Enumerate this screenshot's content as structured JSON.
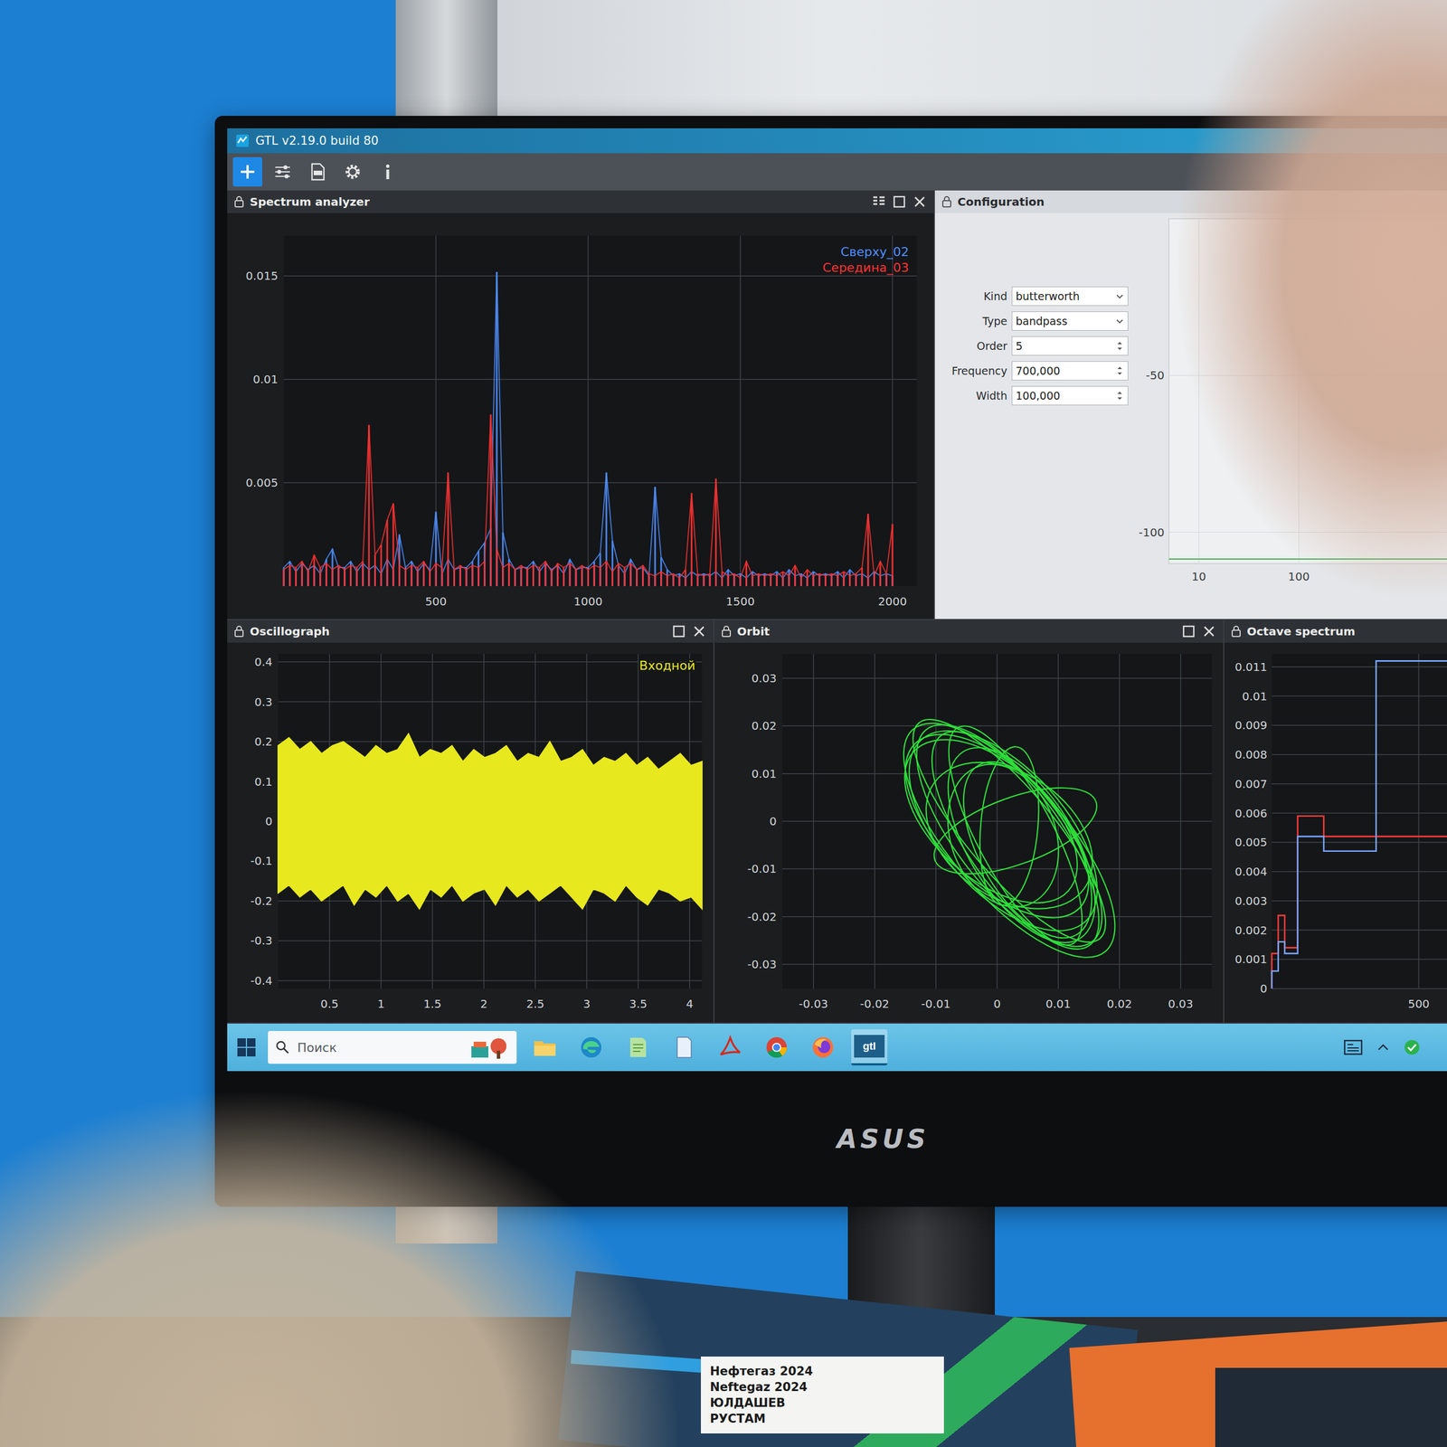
{
  "window": {
    "title": "GTL v2.19.0 build 80"
  },
  "toolbar": {
    "buttons": [
      {
        "kind": "add",
        "selected": true
      },
      {
        "kind": "connect",
        "selected": false
      },
      {
        "kind": "report",
        "selected": false
      },
      {
        "kind": "settings",
        "selected": false
      },
      {
        "kind": "info",
        "selected": false
      }
    ]
  },
  "spectrum": {
    "title": "Spectrum analyzer",
    "y_ticks": [
      "0.015",
      "0.01",
      "0.005"
    ],
    "x_ticks": [
      "500",
      "1000",
      "1500",
      "2000"
    ],
    "series": [
      {
        "name": "Сверху_02",
        "color": "#4f8fff",
        "values": [
          0.0009,
          0.0012,
          0.0007,
          0.0011,
          0.0008,
          0.001,
          0.0006,
          0.0013,
          0.0018,
          0.0009,
          0.0009,
          0.0012,
          0.0007,
          0.0011,
          0.0008,
          0.001,
          0.0006,
          0.0013,
          0.0008,
          0.0025,
          0.0009,
          0.0012,
          0.0007,
          0.0011,
          0.0008,
          0.0036,
          0.0006,
          0.0013,
          0.0008,
          0.0009,
          0.0009,
          0.0012,
          0.0017,
          0.0021,
          0.0028,
          0.0152,
          0.0026,
          0.0013,
          0.0008,
          0.0009,
          0.0009,
          0.0012,
          0.0007,
          0.0011,
          0.0008,
          0.001,
          0.0006,
          0.0013,
          0.0008,
          0.0009,
          0.0009,
          0.0012,
          0.0016,
          0.0055,
          0.0022,
          0.001,
          0.0006,
          0.0013,
          0.0008,
          0.0009,
          0.0005,
          0.0048,
          0.0014,
          0.0008,
          0.0005,
          0.0006,
          0.0004,
          0.0007,
          0.0005,
          0.0006,
          0.0005,
          0.0007,
          0.0004,
          0.0008,
          0.0005,
          0.0006,
          0.0004,
          0.0007,
          0.0005,
          0.0006,
          0.0005,
          0.0007,
          0.0004,
          0.0008,
          0.0005,
          0.0006,
          0.0004,
          0.0007,
          0.0005,
          0.0006,
          0.0005,
          0.0007,
          0.0004,
          0.0008,
          0.0005,
          0.0006,
          0.0004,
          0.0007,
          0.0005,
          0.0006,
          0.0005
        ]
      },
      {
        "name": "Середина_03",
        "color": "#ff3232",
        "values": [
          0.0008,
          0.001,
          0.0009,
          0.0012,
          0.0007,
          0.0015,
          0.0009,
          0.0011,
          0.0008,
          0.001,
          0.0008,
          0.001,
          0.0009,
          0.0012,
          0.0078,
          0.0015,
          0.002,
          0.0032,
          0.004,
          0.001,
          0.0008,
          0.001,
          0.0009,
          0.0012,
          0.0007,
          0.0011,
          0.0009,
          0.0055,
          0.0008,
          0.001,
          0.0008,
          0.001,
          0.0009,
          0.0012,
          0.0083,
          0.0018,
          0.0009,
          0.0011,
          0.0008,
          0.001,
          0.0008,
          0.001,
          0.0009,
          0.0012,
          0.0007,
          0.0011,
          0.0009,
          0.0011,
          0.0008,
          0.001,
          0.0008,
          0.001,
          0.0009,
          0.0012,
          0.0007,
          0.0011,
          0.0009,
          0.0011,
          0.0008,
          0.001,
          0.0006,
          0.0005,
          0.0007,
          0.0005,
          0.0006,
          0.0004,
          0.0008,
          0.0045,
          0.0006,
          0.0005,
          0.0006,
          0.0052,
          0.0007,
          0.0005,
          0.0006,
          0.0004,
          0.0012,
          0.0005,
          0.0006,
          0.0005,
          0.0006,
          0.0005,
          0.0007,
          0.0005,
          0.001,
          0.0004,
          0.0008,
          0.0005,
          0.0006,
          0.0005,
          0.0006,
          0.0005,
          0.0007,
          0.0005,
          0.0006,
          0.0009,
          0.0035,
          0.0005,
          0.0012,
          0.0006,
          0.003
        ]
      }
    ]
  },
  "configuration": {
    "title": "Configuration",
    "fields": [
      {
        "label": "Kind",
        "value": "butterworth",
        "kind": "select"
      },
      {
        "label": "Type",
        "value": "bandpass",
        "kind": "select"
      },
      {
        "label": "Order",
        "value": "5",
        "kind": "spin"
      },
      {
        "label": "Frequency",
        "value": "700,000",
        "kind": "spin"
      },
      {
        "label": "Width",
        "value": "100,000",
        "kind": "spin"
      }
    ],
    "chart": {
      "y_ticks": [
        "-50",
        "-100"
      ],
      "x_ticks": [
        "10",
        "100"
      ]
    }
  },
  "oscillograph": {
    "title": "Oscillograph",
    "y_ticks": [
      "0.4",
      "0.3",
      "0.2",
      "0.1",
      "0",
      "-0.1",
      "-0.2",
      "-0.3",
      "-0.4"
    ],
    "x_ticks": [
      "0.5",
      "1",
      "1.5",
      "2",
      "2.5",
      "3",
      "3.5",
      "4"
    ],
    "series": [
      {
        "name": "Входной",
        "color": "#e8e81e",
        "upper": [
          0.19,
          0.21,
          0.18,
          0.2,
          0.17,
          0.19,
          0.2,
          0.18,
          0.16,
          0.19,
          0.17,
          0.18,
          0.22,
          0.16,
          0.18,
          0.17,
          0.19,
          0.15,
          0.18,
          0.16,
          0.17,
          0.19,
          0.15,
          0.17,
          0.16,
          0.2,
          0.15,
          0.16,
          0.18,
          0.14,
          0.16,
          0.15,
          0.17,
          0.14,
          0.16,
          0.13,
          0.15,
          0.17,
          0.14,
          0.15
        ],
        "lower": [
          -0.18,
          -0.16,
          -0.19,
          -0.17,
          -0.2,
          -0.18,
          -0.16,
          -0.21,
          -0.17,
          -0.19,
          -0.16,
          -0.2,
          -0.18,
          -0.22,
          -0.17,
          -0.19,
          -0.16,
          -0.2,
          -0.18,
          -0.17,
          -0.21,
          -0.16,
          -0.19,
          -0.17,
          -0.2,
          -0.18,
          -0.16,
          -0.19,
          -0.22,
          -0.17,
          -0.18,
          -0.2,
          -0.16,
          -0.19,
          -0.21,
          -0.17,
          -0.18,
          -0.2,
          -0.19,
          -0.22
        ]
      }
    ]
  },
  "orbit": {
    "title": "Orbit",
    "y_ticks": [
      "0.03",
      "0.02",
      "0.01",
      "0",
      "-0.01",
      "-0.02",
      "-0.03"
    ],
    "x_ticks": [
      "-0.03",
      "-0.02",
      "-0.01",
      "0",
      "0.01",
      "0.02",
      "0.03"
    ],
    "color": "#2ee03a",
    "loops": [
      {
        "cx": 0.002,
        "cy": -0.003,
        "rx": 0.022,
        "ry": 0.011,
        "angle": 52
      },
      {
        "cx": 0.001,
        "cy": -0.002,
        "rx": 0.02,
        "ry": 0.013,
        "angle": 48
      },
      {
        "cx": 0.003,
        "cy": -0.004,
        "rx": 0.021,
        "ry": 0.01,
        "angle": 55
      },
      {
        "cx": 0.0,
        "cy": -0.001,
        "rx": 0.019,
        "ry": 0.012,
        "angle": 45
      },
      {
        "cx": 0.004,
        "cy": -0.005,
        "rx": 0.018,
        "ry": 0.011,
        "angle": 58
      },
      {
        "cx": 0.002,
        "cy": -0.002,
        "rx": 0.023,
        "ry": 0.009,
        "angle": 50
      },
      {
        "cx": -0.001,
        "cy": 0.0,
        "rx": 0.017,
        "ry": 0.012,
        "angle": 42
      },
      {
        "cx": 0.005,
        "cy": -0.006,
        "rx": 0.016,
        "ry": 0.01,
        "angle": 60
      },
      {
        "cx": 0.002,
        "cy": -0.003,
        "rx": 0.015,
        "ry": 0.013,
        "angle": 35
      },
      {
        "cx": 0.003,
        "cy": -0.003,
        "rx": 0.02,
        "ry": 0.008,
        "angle": 62
      },
      {
        "cx": 0.001,
        "cy": -0.003,
        "rx": 0.012,
        "ry": 0.011,
        "angle": 70
      },
      {
        "cx": 0.003,
        "cy": -0.002,
        "rx": 0.014,
        "ry": 0.007,
        "angle": -20
      },
      {
        "cx": 0.002,
        "cy": -0.001,
        "rx": 0.013,
        "ry": 0.006,
        "angle": 95
      },
      {
        "cx": 0.002,
        "cy": -0.004,
        "rx": 0.024,
        "ry": 0.012,
        "angle": 49
      }
    ]
  },
  "octave": {
    "title": "Octave spectrum",
    "y_ticks": [
      "0.011",
      "0.01",
      "0.009",
      "0.008",
      "0.007",
      "0.006",
      "0.005",
      "0.004",
      "0.003",
      "0.002",
      "0.001",
      "0"
    ],
    "x_ticks": [
      "500"
    ],
    "band_edges": [
      0,
      22,
      44,
      88,
      177,
      355,
      710
    ],
    "series": [
      {
        "color": "#ff3a3a",
        "values": [
          0.0012,
          0.0025,
          0.0014,
          0.0059,
          0.0052,
          0.0052
        ]
      },
      {
        "color": "#7aa6ff",
        "values": [
          0.0006,
          0.0016,
          0.0012,
          0.0052,
          0.0047,
          0.0112
        ]
      }
    ]
  },
  "taskbar": {
    "search_placeholder": "Поиск",
    "apps": [
      {
        "kind": "explorer",
        "label": "",
        "selected": false
      },
      {
        "kind": "edge",
        "label": "",
        "selected": false
      },
      {
        "kind": "notes",
        "label": "",
        "selected": false
      },
      {
        "kind": "document",
        "label": "",
        "selected": false
      },
      {
        "kind": "pdf",
        "label": "",
        "selected": false
      },
      {
        "kind": "chrome",
        "label": "",
        "selected": false
      },
      {
        "kind": "firefox",
        "label": "",
        "selected": false
      },
      {
        "kind": "gtl",
        "label": "gtl",
        "selected": true
      }
    ]
  },
  "monitor": {
    "brand": "ASUS"
  },
  "badge": {
    "lines": [
      "Нефтегаз 2024",
      "Neftegaz 2024",
      "ЮЛДАШЕВ",
      "РУСТАМ"
    ]
  }
}
